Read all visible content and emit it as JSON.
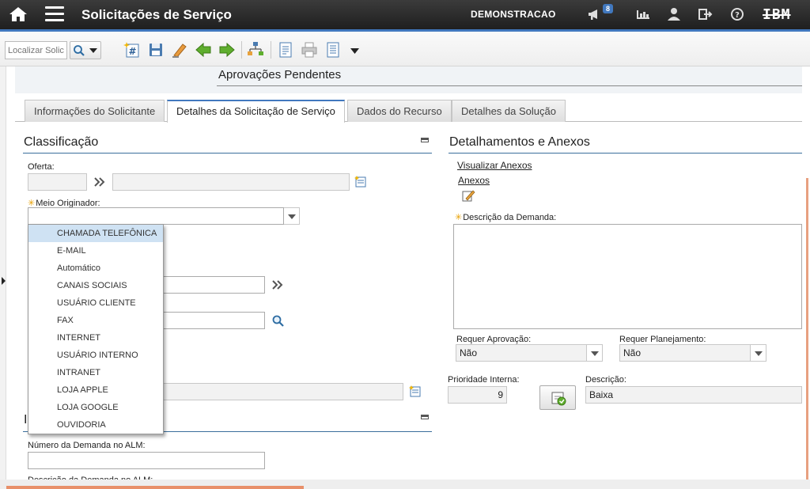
{
  "app": {
    "title": "Solicitações de Serviço",
    "user": "DEMONSTRACAO",
    "notification_count": "8",
    "logo": "IBM"
  },
  "toolbar": {
    "search_placeholder": "Localizar Solicitação",
    "icons": [
      "new-record-icon",
      "save-icon",
      "clear-icon",
      "previous-arrow-icon",
      "next-arrow-icon",
      "workflow-icon",
      "report-icon",
      "print-icon",
      "report-list-icon",
      "more-dropdown-icon"
    ]
  },
  "header": {
    "pending_title": "Aprovações Pendentes"
  },
  "tabs": [
    {
      "label": "Informações do Solicitante"
    },
    {
      "label": "Detalhes da Solicitação de Serviço"
    },
    {
      "label": "Dados do Recurso"
    },
    {
      "label": "Detalhes da Solução"
    }
  ],
  "classification": {
    "title": "Classificação",
    "oferta_label": "Oferta:",
    "meio_label": "Meio Originador:",
    "meio_value": "",
    "options": [
      "CHAMADA TELEFÔNICA",
      "E-MAIL",
      "Automático",
      "CANAIS SOCIAIS",
      "USUÁRIO CLIENTE",
      "FAX",
      "INTERNET",
      "USUÁRIO INTERNO",
      "INTRANET",
      "LOJA APPLE",
      "LOJA GOOGLE",
      "OUVIDORIA"
    ]
  },
  "section2": {
    "title_visible": "I",
    "alm_number_label": "Número da Demanda no ALM:",
    "alm_desc_label": "Descrição da Demanda no ALM:"
  },
  "details": {
    "title": "Detalhamentos e Anexos",
    "view_attachments": "Visualizar Anexos",
    "attachments": "Anexos",
    "demand_desc_label": "Descrição da Demanda:",
    "requires_approval_label": "Requer Aprovação:",
    "requires_approval_value": "Não",
    "requires_planning_label": "Requer Planejamento:",
    "requires_planning_value": "Não",
    "internal_priority_label": "Prioridade Interna:",
    "internal_priority_value": "9",
    "description_label": "Descrição:",
    "description_value": "Baixa"
  },
  "colors": {
    "accent": "#4178be",
    "topbar": "#2a2a2a",
    "selected_option": "#cfe2f3",
    "required_marker": "#e8a000"
  }
}
